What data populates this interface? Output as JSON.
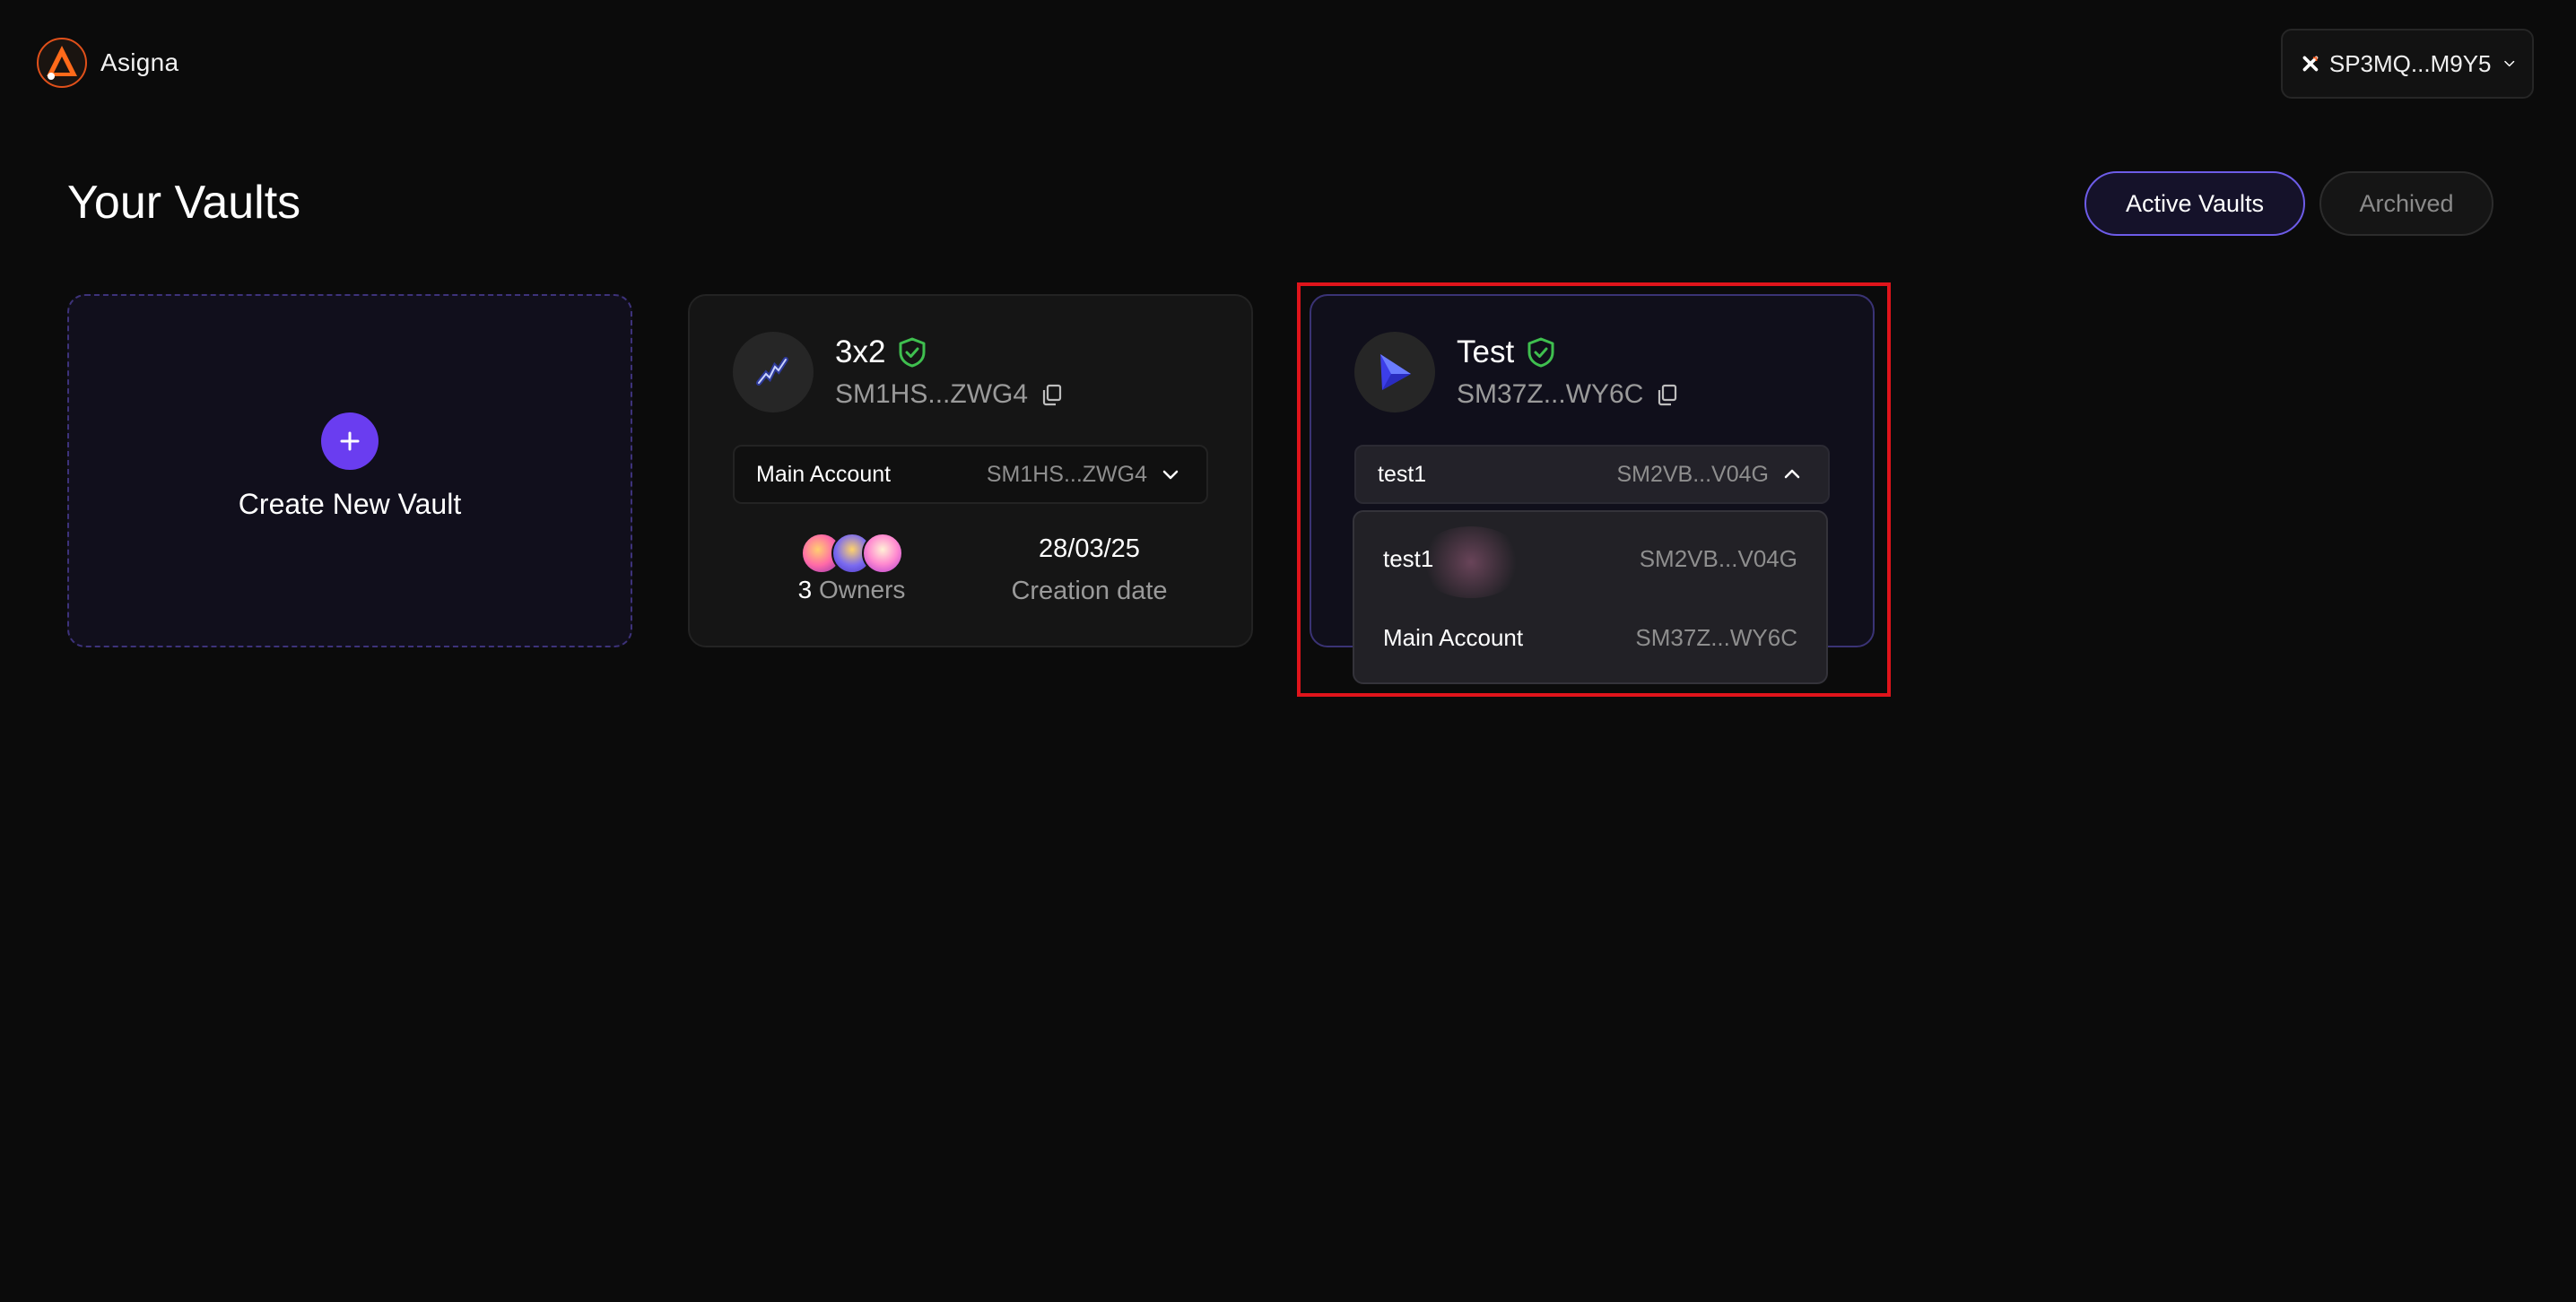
{
  "app": {
    "name": "Asigna"
  },
  "wallet": {
    "address": "SP3MQ...M9Y5"
  },
  "page": {
    "title": "Your Vaults"
  },
  "tabs": [
    {
      "label": "Active Vaults",
      "active": true
    },
    {
      "label": "Archived",
      "active": false
    }
  ],
  "create_card": {
    "label": "Create New Vault"
  },
  "vaults": [
    {
      "name": "3x2",
      "address": "SM1HS...ZWG4",
      "account": {
        "label": "Main Account",
        "address": "SM1HS...ZWG4"
      },
      "owners_count": "3",
      "owners_label": "Owners",
      "creation_date": "28/03/25",
      "creation_date_label": "Creation date"
    },
    {
      "name": "Test",
      "address": "SM37Z...WY6C",
      "account": {
        "label": "test1",
        "address": "SM2VB...V04G"
      },
      "dropdown_open": true,
      "options": [
        {
          "label": "test1",
          "address": "SM2VB...V04G"
        },
        {
          "label": "Main Account",
          "address": "SM37Z...WY6C"
        }
      ]
    }
  ],
  "colors": {
    "accent": "#6a3df0",
    "verified": "#3fbf4f",
    "highlight": "#e0141b",
    "background": "#0b0b0b"
  }
}
